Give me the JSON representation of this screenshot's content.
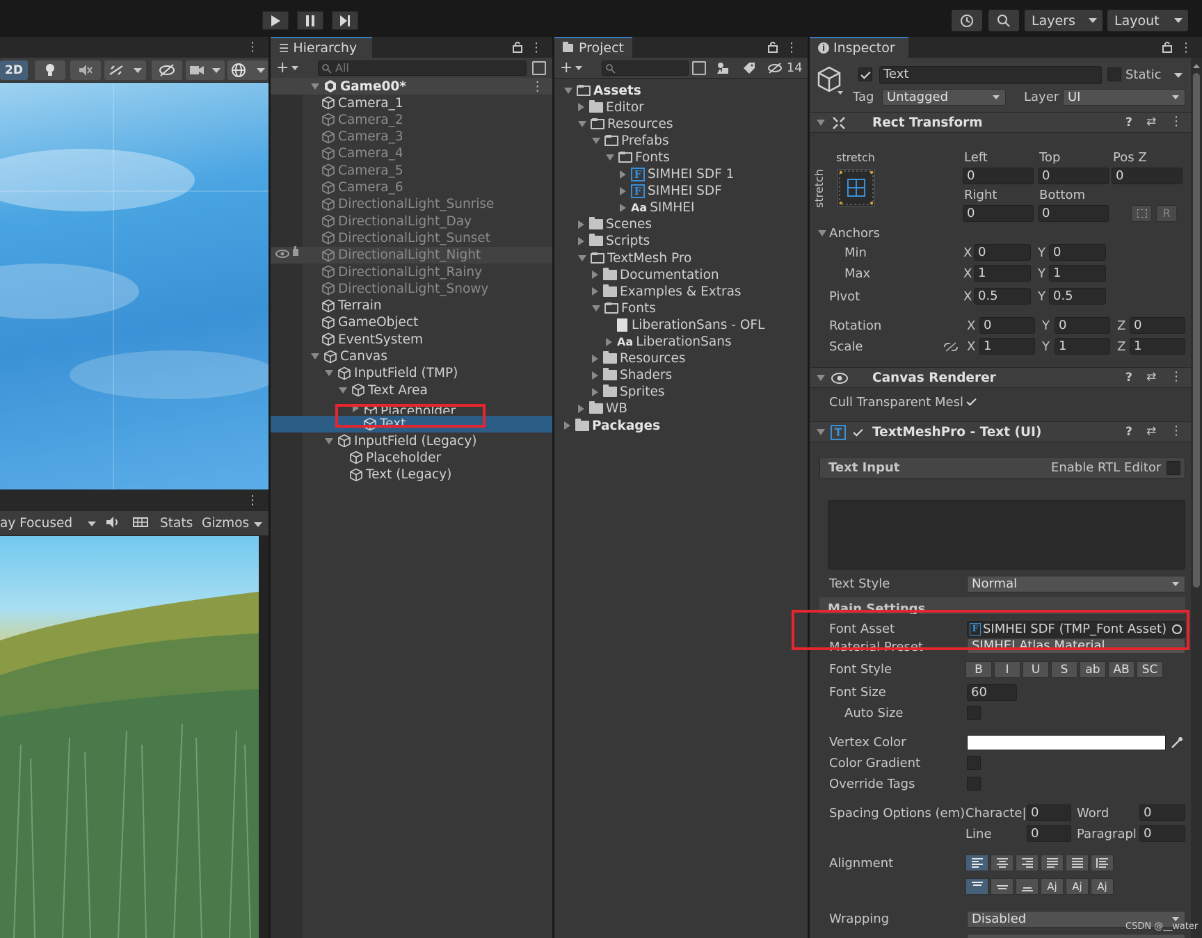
{
  "topbar": {
    "layers_label": "Layers",
    "layout_label": "Layout"
  },
  "scene": {
    "mode_2d": "2D"
  },
  "game": {
    "play_focused": "ay Focused",
    "stats": "Stats",
    "gizmos": "Gizmos"
  },
  "hierarchy": {
    "tab": "Hierarchy",
    "search_placeholder": "All",
    "scene_name": "Game00*",
    "items": [
      {
        "label": "Camera_1",
        "dim": false
      },
      {
        "label": "Camera_2",
        "dim": true
      },
      {
        "label": "Camera_3",
        "dim": true
      },
      {
        "label": "Camera_4",
        "dim": true
      },
      {
        "label": "Camera_5",
        "dim": true
      },
      {
        "label": "Camera_6",
        "dim": true
      },
      {
        "label": "DirectionalLight_Sunrise",
        "dim": true
      },
      {
        "label": "DirectionalLight_Day",
        "dim": true
      },
      {
        "label": "DirectionalLight_Sunset",
        "dim": true
      },
      {
        "label": "DirectionalLight_Night",
        "dim": true
      },
      {
        "label": "DirectionalLight_Rainy",
        "dim": true
      },
      {
        "label": "DirectionalLight_Snowy",
        "dim": true
      },
      {
        "label": "Terrain",
        "dim": false
      },
      {
        "label": "GameObject",
        "dim": false
      },
      {
        "label": "EventSystem",
        "dim": false
      },
      {
        "label": "Canvas",
        "dim": false
      },
      {
        "label": "InputField (TMP)",
        "dim": false
      },
      {
        "label": "Text Area",
        "dim": false
      },
      {
        "label": "Placeholder",
        "dim": false
      },
      {
        "label": "Text",
        "dim": false
      },
      {
        "label": "InputField (Legacy)",
        "dim": false
      },
      {
        "label": "Placeholder",
        "dim": false
      },
      {
        "label": "Text (Legacy)",
        "dim": false
      }
    ]
  },
  "project": {
    "tab": "Project",
    "hidden_count": "14",
    "items": [
      {
        "label": "Assets"
      },
      {
        "label": "Editor"
      },
      {
        "label": "Resources"
      },
      {
        "label": "Prefabs"
      },
      {
        "label": "Fonts"
      },
      {
        "label": "SIMHEI SDF 1"
      },
      {
        "label": "SIMHEI SDF"
      },
      {
        "label": "SIMHEI"
      },
      {
        "label": "Scenes"
      },
      {
        "label": "Scripts"
      },
      {
        "label": "TextMesh Pro"
      },
      {
        "label": "Documentation"
      },
      {
        "label": "Examples & Extras"
      },
      {
        "label": "Fonts"
      },
      {
        "label": "LiberationSans - OFL"
      },
      {
        "label": "LiberationSans"
      },
      {
        "label": "Resources"
      },
      {
        "label": "Shaders"
      },
      {
        "label": "Sprites"
      },
      {
        "label": "WB"
      },
      {
        "label": "Packages"
      }
    ]
  },
  "inspector": {
    "tab": "Inspector",
    "object_name": "Text",
    "static_label": "Static",
    "tag_label": "Tag",
    "tag_value": "Untagged",
    "layer_label": "Layer",
    "layer_value": "UI",
    "rect": {
      "title": "Rect Transform",
      "stretch_h": "stretch",
      "stretch_v": "stretch",
      "left_label": "Left",
      "left": "0",
      "top_label": "Top",
      "top": "0",
      "posz_label": "Pos Z",
      "posz": "0",
      "right_label": "Right",
      "right": "0",
      "bottom_label": "Bottom",
      "bottom": "0",
      "r_btn": "R",
      "anchors_label": "Anchors",
      "min_label": "Min",
      "min_x": "0",
      "min_y": "0",
      "max_label": "Max",
      "max_x": "1",
      "max_y": "1",
      "pivot_label": "Pivot",
      "pivot_x": "0.5",
      "pivot_y": "0.5",
      "rotation_label": "Rotation",
      "rot_x": "0",
      "rot_y": "0",
      "rot_z": "0",
      "scale_label": "Scale",
      "scale_x": "1",
      "scale_y": "1",
      "scale_z": "1",
      "x": "X",
      "y": "Y",
      "z": "Z"
    },
    "canvas_renderer": {
      "title": "Canvas Renderer",
      "cull_label": "Cull Transparent Mesl"
    },
    "tmp": {
      "title": "TextMeshPro - Text (UI)",
      "text_input_label": "Text Input",
      "rtl_label": "Enable RTL Editor",
      "text_style_label": "Text Style",
      "text_style_value": "Normal",
      "main_settings_label": "Main Settings",
      "font_asset_label": "Font Asset",
      "font_asset_value": "SIMHEI SDF (TMP_Font Asset)",
      "material_label": "Material Preset",
      "material_value": "SIMHEI Atlas Material",
      "font_style_label": "Font Style",
      "style_buttons": [
        "B",
        "I",
        "U",
        "S",
        "ab",
        "AB",
        "SC"
      ],
      "font_size_label": "Font Size",
      "font_size_value": "60",
      "auto_size_label": "Auto Size",
      "vertex_color_label": "Vertex Color",
      "color_gradient_label": "Color Gradient",
      "override_tags_label": "Override Tags",
      "spacing_label": "Spacing Options (em)",
      "character_label": "Characte|",
      "character_value": "0",
      "word_label": "Word",
      "word_value": "0",
      "line_label": "Line",
      "line_value": "0",
      "paragraph_label": "Paragrapl",
      "paragraph_value": "0",
      "alignment_label": "Alignment",
      "wrapping_label": "Wrapping",
      "wrapping_value": "Disabled"
    }
  },
  "watermark": "CSDN @__water",
  "colors": {
    "selection": "#2c5d87",
    "accent": "#3a79bb",
    "highlight_box": "#e6262e"
  }
}
